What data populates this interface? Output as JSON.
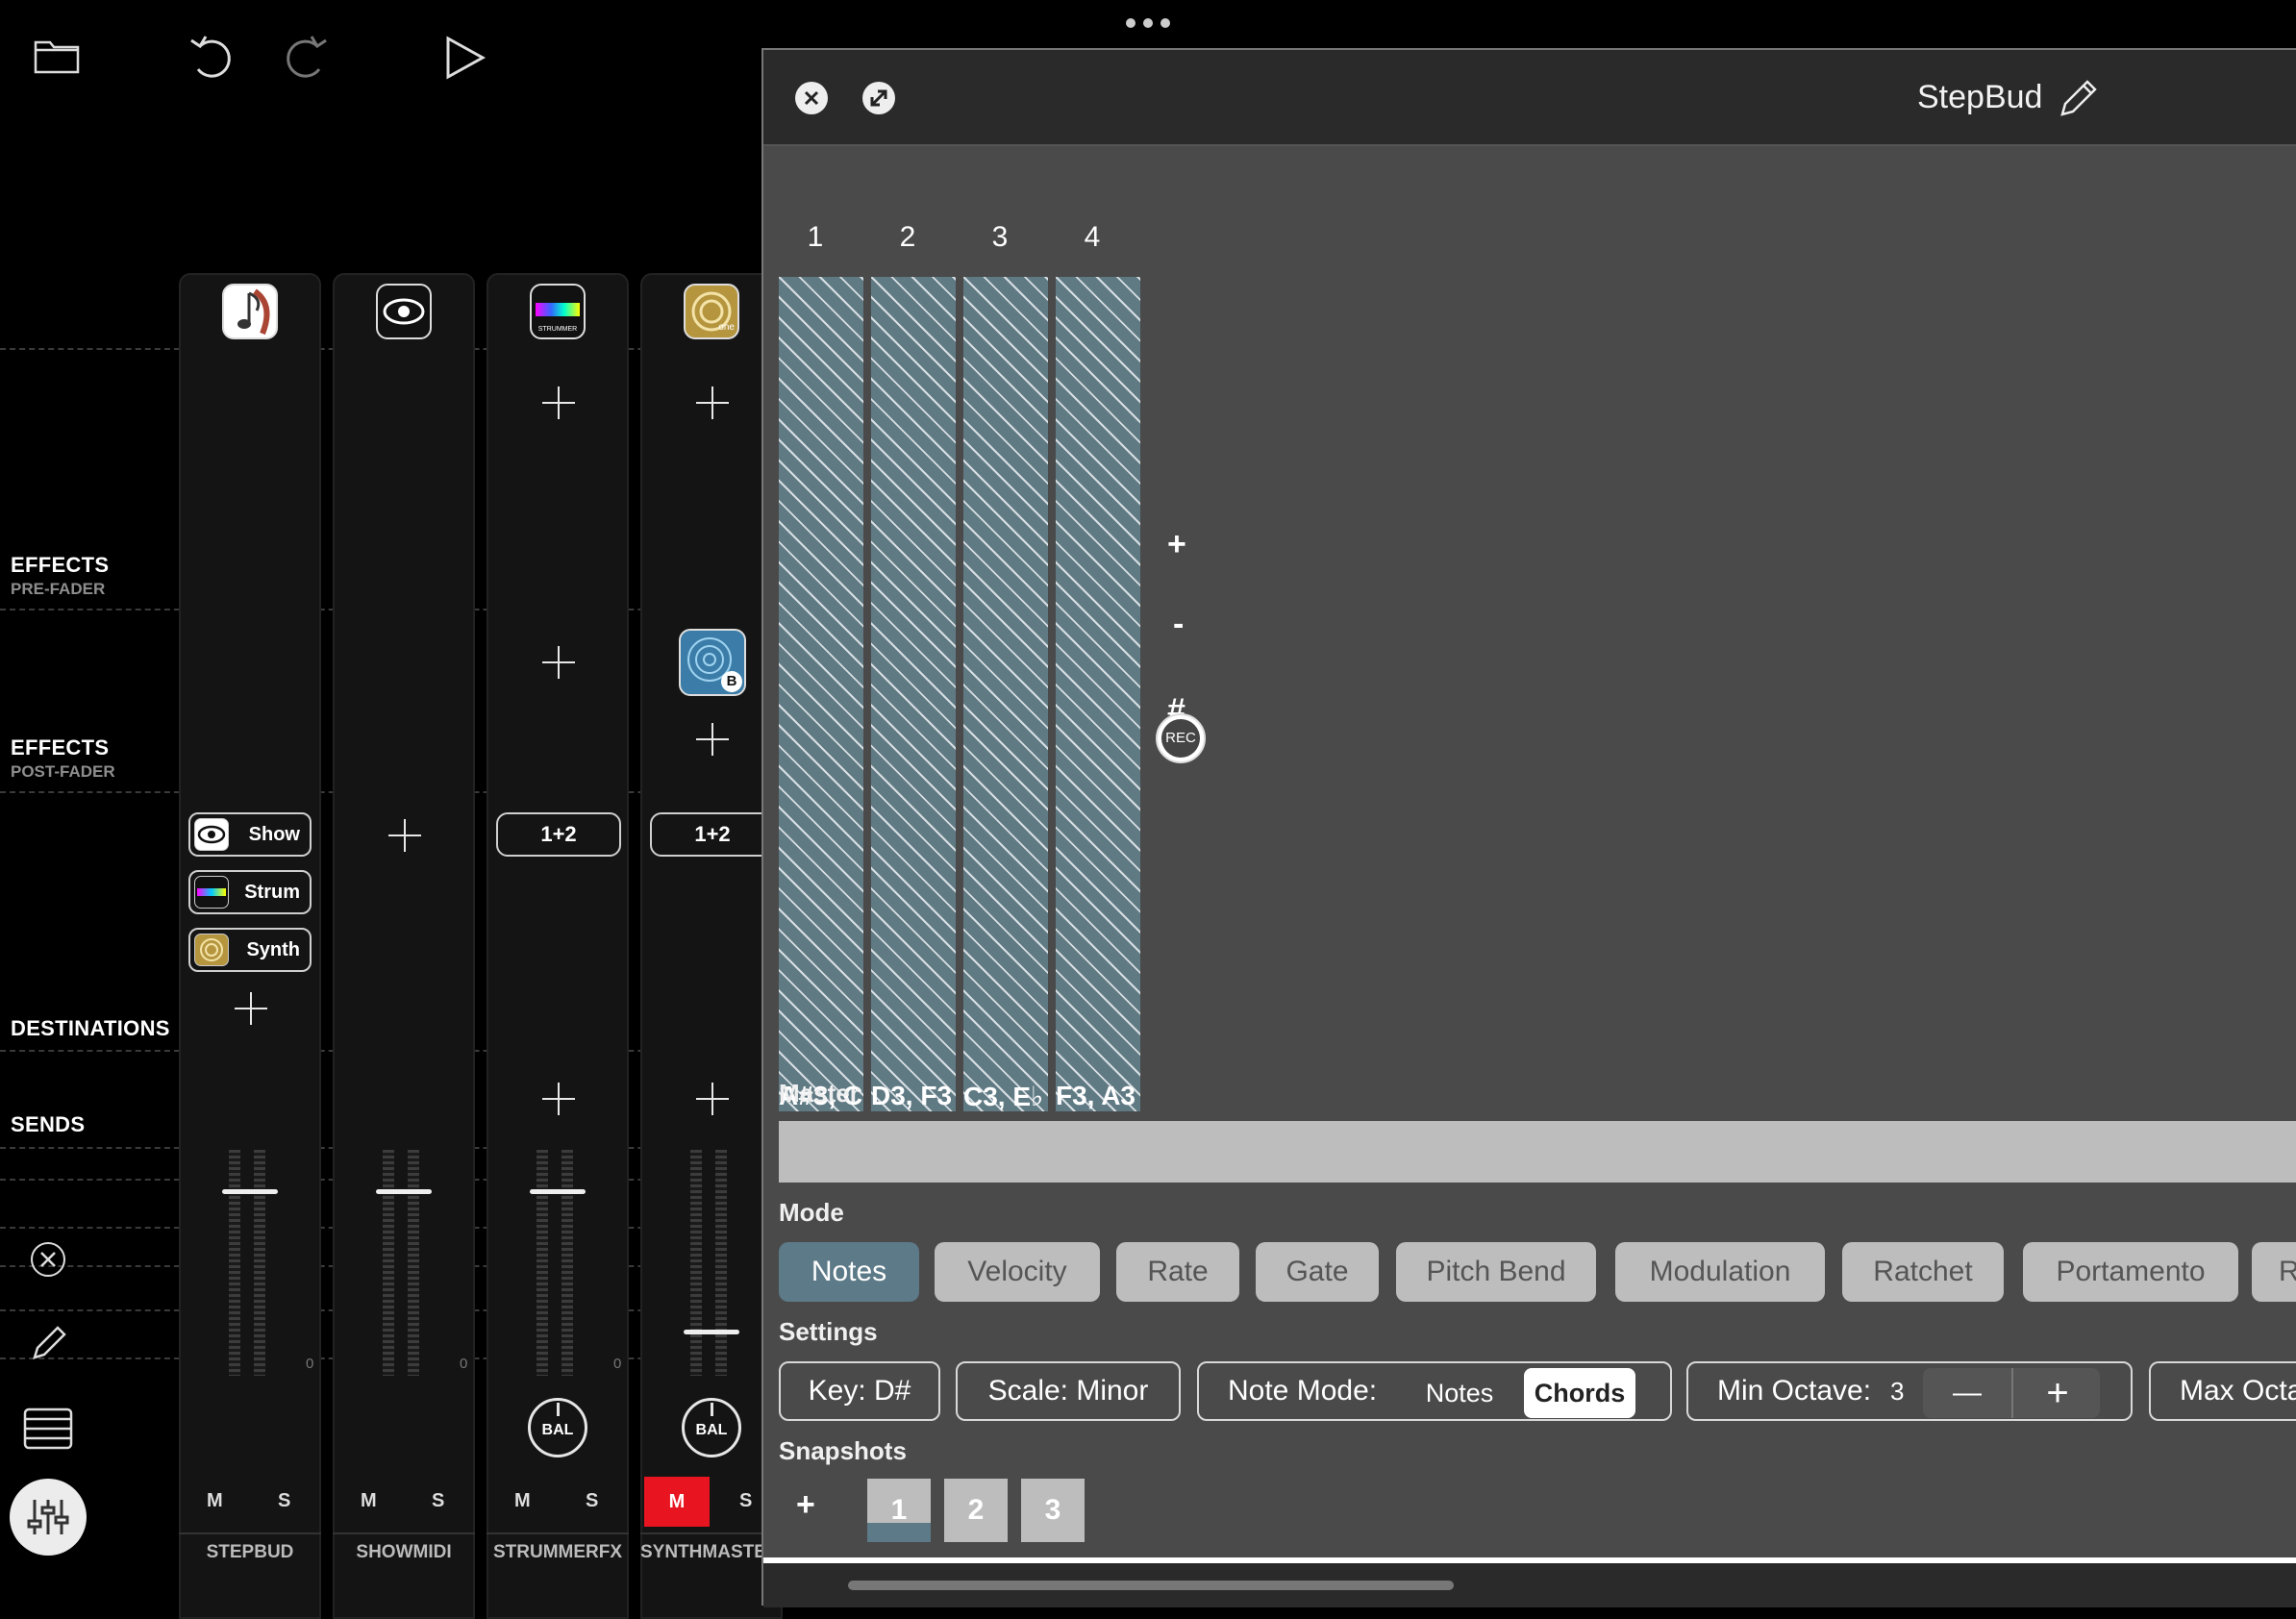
{
  "toolbar": {
    "folder_icon": "folder-icon",
    "undo_icon": "undo-icon",
    "redo_icon": "redo-icon",
    "play_icon": "play-icon"
  },
  "sections": {
    "effects_pre": "EFFECTS",
    "effects_pre_sub": "PRE-FADER",
    "effects_post": "EFFECTS",
    "effects_post_sub": "POST-FADER",
    "destinations": "DESTINATIONS",
    "sends": "SENDS"
  },
  "strips": [
    {
      "name": "STEPBUD",
      "mute": "M",
      "solo": "S",
      "zero": "0"
    },
    {
      "name": "SHOWMIDI",
      "mute": "M",
      "solo": "S",
      "zero": "0"
    },
    {
      "name": "STRUMMERFX",
      "mute": "M",
      "solo": "S",
      "zero": "0",
      "route": "1+2",
      "bal": "BAL"
    },
    {
      "name": "SYNTHMASTER",
      "mute": "M",
      "solo": "S",
      "route": "1+2",
      "bal": "BAL",
      "mute_active": true
    }
  ],
  "destinations": [
    {
      "label": "Show",
      "icon": "eye-icon"
    },
    {
      "label": "Strum",
      "icon": "strummer-icon"
    },
    {
      "label": "Synth",
      "icon": "synth-icon"
    }
  ],
  "plugin_badges": {
    "strummer_text": "STRUMMER",
    "synth_text": "one",
    "bubble_badge": "B"
  },
  "window": {
    "title": "StepBud",
    "steps": [
      {
        "num": "1",
        "label": "A#3, C"
      },
      {
        "num": "2",
        "label": "D3, F3"
      },
      {
        "num": "3",
        "label": "C3, E♭"
      },
      {
        "num": "4",
        "label": "F3, A3"
      }
    ],
    "controls": {
      "plus": "+",
      "minus": "-",
      "sharp": "#",
      "rec": "REC"
    },
    "master_label": "Master",
    "mode_label": "Mode",
    "modes": [
      "Notes",
      "Velocity",
      "Rate",
      "Gate",
      "Pitch Bend",
      "Modulation",
      "Ratchet",
      "Portamento",
      "R"
    ],
    "selected_mode": "Notes",
    "settings_label": "Settings",
    "key": "Key: D#",
    "scale": "Scale: Minor",
    "note_mode_label": "Note Mode:",
    "note_mode_options": [
      "Notes",
      "Chords"
    ],
    "note_mode_selected": "Chords",
    "min_octave_label": "Min Octave:",
    "min_octave_value": "3",
    "stepper_minus": "—",
    "stepper_plus": "+",
    "max_octave_label": "Max Octa",
    "snapshots_label": "Snapshots",
    "snapshot_add": "+",
    "snapshots": [
      "1",
      "2",
      "3"
    ],
    "colors": {
      "accent": "#5d7a88",
      "mute_red": "#e8141f"
    }
  }
}
